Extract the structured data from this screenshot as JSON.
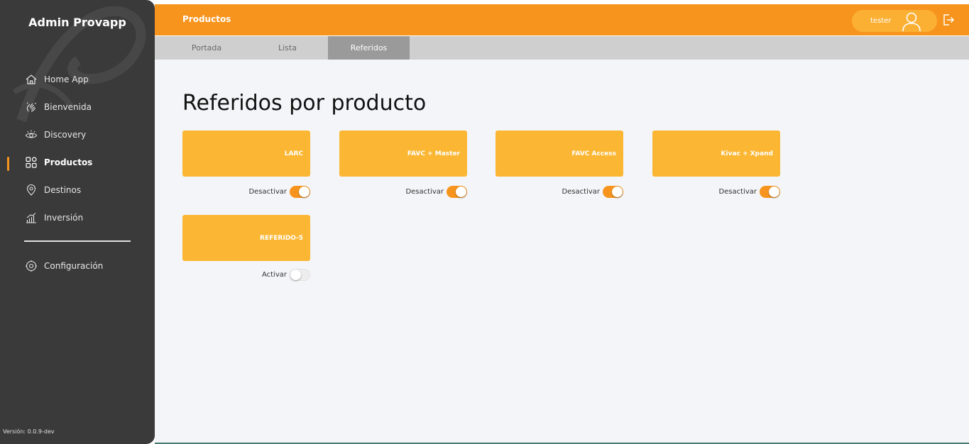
{
  "app": {
    "brand": "Admin Provapp",
    "version": "Versión: 0.0.9-dev"
  },
  "sidebar": {
    "items": [
      {
        "label": "Home App",
        "icon": "home-icon"
      },
      {
        "label": "Bienvenida",
        "icon": "wave-hand-icon"
      },
      {
        "label": "Discovery",
        "icon": "eye-icon"
      },
      {
        "label": "Productos",
        "icon": "grid-icon",
        "active": true
      },
      {
        "label": "Destinos",
        "icon": "location-pin-icon"
      },
      {
        "label": "Inversión",
        "icon": "chart-icon"
      }
    ],
    "settings": {
      "label": "Configuración",
      "icon": "gear-icon"
    }
  },
  "header": {
    "title": "Productos",
    "user": "tester",
    "avatar_icon": "user-icon",
    "logout_icon": "logout-icon"
  },
  "tabs": [
    {
      "label": "Portada"
    },
    {
      "label": "Lista"
    },
    {
      "label": "Referidos",
      "active": true
    }
  ],
  "main": {
    "title": "Referidos por producto",
    "cards": [
      {
        "name": "LARC",
        "toggle_label": "Desactivar",
        "enabled": true
      },
      {
        "name": "FAVC + Master",
        "toggle_label": "Desactivar",
        "enabled": true
      },
      {
        "name": "FAVC Access",
        "toggle_label": "Desactivar",
        "enabled": true
      },
      {
        "name": "Kivac + Xpand",
        "toggle_label": "Desactivar",
        "enabled": true
      },
      {
        "name": "REFERIDO-5",
        "toggle_label": "Activar",
        "enabled": false
      }
    ]
  },
  "colors": {
    "accent": "#f7941d",
    "card": "#fbb734",
    "sidebar": "#3a3a3a",
    "background": "#f4f5f8"
  }
}
